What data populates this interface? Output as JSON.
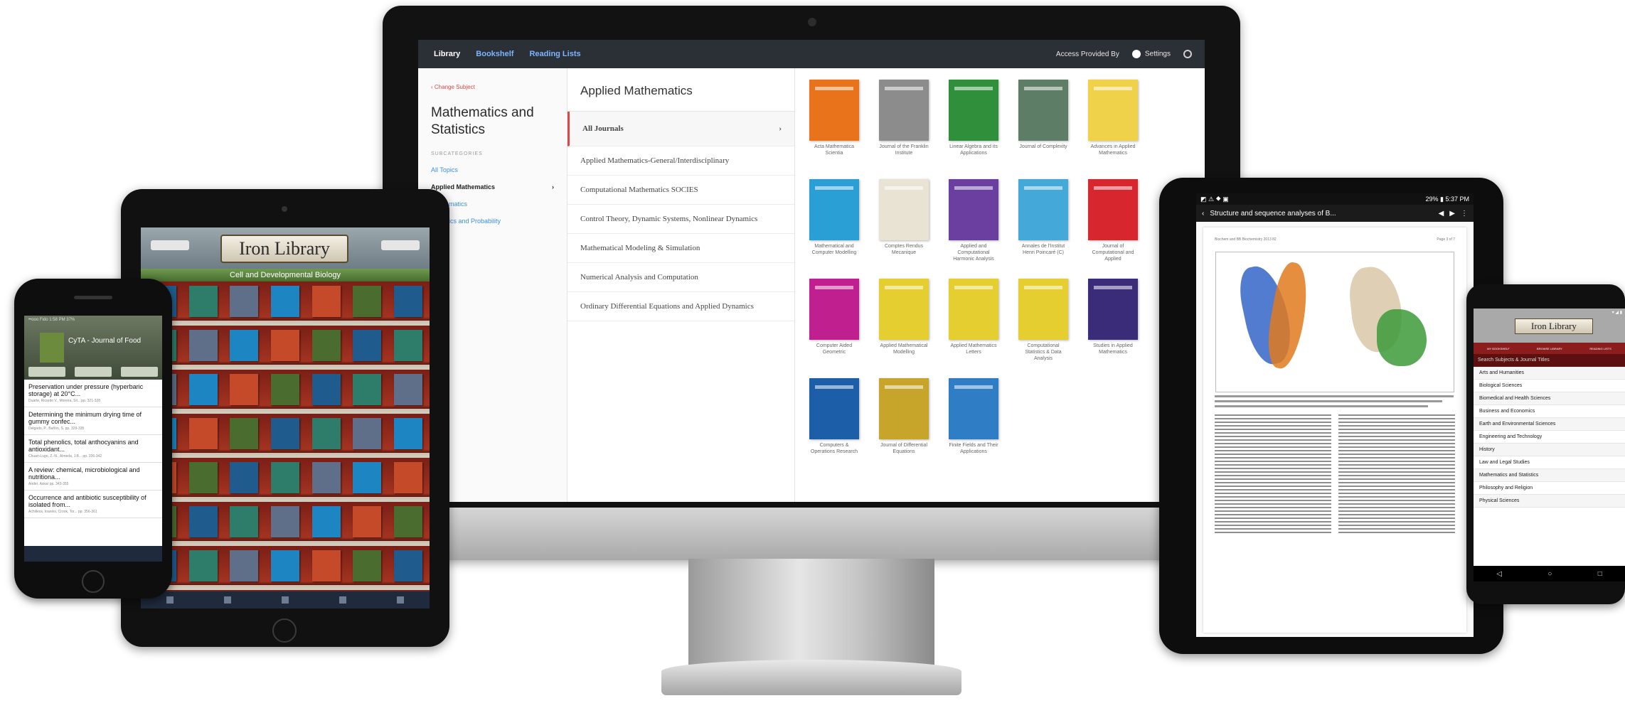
{
  "monitor": {
    "nav": {
      "library": "Library",
      "bookshelf": "Bookshelf",
      "reading_lists": "Reading Lists",
      "access_provided": "Access Provided By",
      "settings": "Settings"
    },
    "change_subject": "‹ Change Subject",
    "subject_title": "Mathematics and Statistics",
    "subcategories_label": "SUBCATEGORIES",
    "subjects": [
      {
        "label": "All Topics"
      },
      {
        "label": "Applied Mathematics",
        "arrow": "›"
      },
      {
        "label": "Mathematics"
      },
      {
        "label": "Statistics and Probability"
      }
    ],
    "category_title": "Applied Mathematics",
    "journal_categories": [
      {
        "label": "All Journals",
        "arrow": "›"
      },
      {
        "label": "Applied Mathematics-General/Interdisciplinary"
      },
      {
        "label": "Computational Mathematics SOCIES"
      },
      {
        "label": "Control Theory, Dynamic Systems, Nonlinear Dynamics"
      },
      {
        "label": "Mathematical Modeling & Simulation"
      },
      {
        "label": "Numerical Analysis and Computation"
      },
      {
        "label": "Ordinary Differential Equations and Applied Dynamics"
      }
    ],
    "journals": [
      {
        "name": "Acta Mathematica Scientia",
        "color": "#e8731b"
      },
      {
        "name": "Journal of the Franklin Institute",
        "color": "#8c8c8c"
      },
      {
        "name": "Linear Algebra and its Applications",
        "color": "#2f8f3a"
      },
      {
        "name": "Journal of Complexity",
        "color": "#5d7d67"
      },
      {
        "name": "Advances in Applied Mathematics",
        "color": "#f0d24a"
      },
      {
        "name": "Mathematical and Computer Modelling",
        "color": "#2a9fd6"
      },
      {
        "name": "Comptes Rendus Mecanique",
        "color": "#e9e3d4"
      },
      {
        "name": "Applied and Computational Harmonic Analysis",
        "color": "#6a3fa0"
      },
      {
        "name": "Annales de l'Institut Henri Poincaré (C)",
        "color": "#44a8d8"
      },
      {
        "name": "Journal of Computational and Applied",
        "color": "#d8262f"
      },
      {
        "name": "Computer Aided Geometric",
        "color": "#c0208f"
      },
      {
        "name": "Applied Mathematical Modelling",
        "color": "#e5cf30"
      },
      {
        "name": "Applied Mathematics Letters",
        "color": "#e5cf30"
      },
      {
        "name": "Computational Statistics & Data Analysis",
        "color": "#e5cf30"
      },
      {
        "name": "Studies in Applied Mathematics",
        "color": "#3a2c78"
      },
      {
        "name": "Computers & Operations Research",
        "color": "#1d5ea8"
      },
      {
        "name": "Journal of Differential Equations",
        "color": "#c7a52a"
      },
      {
        "name": "Finite Fields and Their Applications",
        "color": "#2f7dc4"
      }
    ]
  },
  "ipad": {
    "brand": "Iron Library",
    "category": "Cell and Developmental Biology",
    "book_colors": [
      "#1f5b8c",
      "#2e7d6a",
      "#5f6f8a",
      "#1d86c2",
      "#c44a2a",
      "#4a6c2f"
    ]
  },
  "iphone": {
    "status": "••ooo Fido   1:58 PM   37%",
    "journal_title": "CyTA - Journal of Food",
    "articles": [
      {
        "title": "Preservation under pressure (hyperbaric storage) at 20°C...",
        "authors": "Duarte, Ricardo V., Moreira, Sil...   pp. 321-328"
      },
      {
        "title": "Determining the minimum drying time of gummy confec...",
        "authors": "Delgado, P., Bañón, S.   pp. 329-335"
      },
      {
        "title": "Total phenolics, total anthocyanins and antioxidant...",
        "authors": "Chuan-Lugo, Z.-N., Almeda, J.B...   pp. 336-342"
      },
      {
        "title": "A review: chemical, microbiological and nutritiona...",
        "authors": "Ander, Askar   pp. 343-355"
      },
      {
        "title": "Occurrence and antibiotic susceptibility of isolated from...",
        "authors": "Achilleos, Ioannis, Crook, Tor...   pp. 356-361"
      }
    ]
  },
  "tablet": {
    "status_left": "◩ ⚠ ⯁ ▣",
    "status_right": "29% ▮ 5:37 PM",
    "title": "Structure and sequence analyses of B...",
    "page_header_left": "Biochem and BB Biochemistry 2013 82",
    "page_header_right": "Page 3 of 7"
  },
  "android_phone": {
    "brand": "Iron Library",
    "tabs": [
      "MY BOOKSHELF",
      "BROWSE LIBRARY",
      "READING LISTS"
    ],
    "search": "Search Subjects & Journal Titles",
    "subjects": [
      "Arts and Humanities",
      "Biological Sciences",
      "Biomedical and Health Sciences",
      "Business and Economics",
      "Earth and Environmental Sciences",
      "Engineering and Technology",
      "History",
      "Law and Legal Studies",
      "Mathematics and Statistics",
      "Philosophy and Religion",
      "Physical Sciences"
    ],
    "nav": [
      "◁",
      "○",
      "□"
    ]
  }
}
